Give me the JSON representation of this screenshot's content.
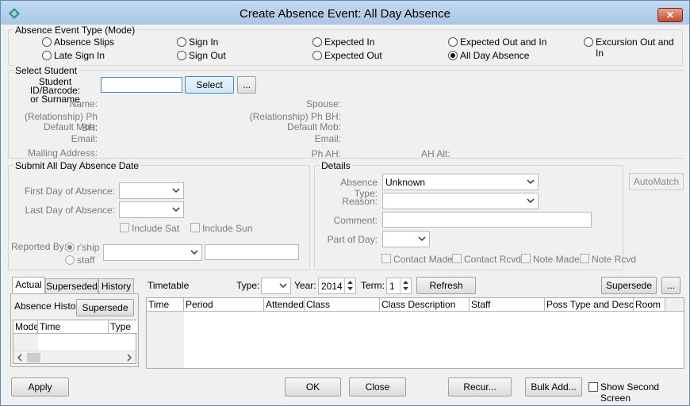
{
  "window": {
    "title": "Create Absence Event: All Day Absence",
    "close": "✕"
  },
  "mode": {
    "label": "Absence Event Type (Mode)",
    "options": [
      {
        "label": "Absence Slips",
        "checked": false
      },
      {
        "label": "Sign In",
        "checked": false
      },
      {
        "label": "Expected In",
        "checked": false
      },
      {
        "label": "Expected Out and In",
        "checked": false
      },
      {
        "label": "Excursion Out and In",
        "checked": false
      },
      {
        "label": "Late Sign In",
        "checked": false
      },
      {
        "label": "Sign Out",
        "checked": false
      },
      {
        "label": "Expected Out",
        "checked": false
      },
      {
        "label": "All Day Absence",
        "checked": true
      }
    ]
  },
  "student": {
    "label": "Select Student",
    "id_label_line1": "Student ID/Barcode:",
    "id_label_line2": "or Surname",
    "id_value": "",
    "select_button": "Select",
    "more_button": "...",
    "name_label": "Name:",
    "relationship_label": "(Relationship) Ph BH:",
    "default_mob_label": "Default Mob:",
    "email_label": "Email:",
    "mailing_label": "Mailing Address:",
    "spouse_label": "Spouse:",
    "spouse_relationship_label": "(Relationship) Ph BH:",
    "spouse_default_mob_label": "Default Mob:",
    "spouse_email_label": "Email:",
    "ph_ah_label": "Ph AH:",
    "ah_alt_label": "AH Alt:"
  },
  "submit": {
    "label": "Submit All Day Absence Date",
    "first_day_label": "First Day of Absence:",
    "last_day_label": "Last Day of Absence:",
    "include_sat": "Include Sat",
    "include_sun": "Include Sun",
    "reported_by_label": "Reported By:",
    "rship": "r'ship",
    "staff": "staff"
  },
  "details": {
    "label": "Details",
    "automatch": "AutoMatch",
    "absence_type_label": "Absence Type:",
    "absence_type_value": "Unknown",
    "reason_label": "Reason:",
    "comment_label": "Comment:",
    "part_of_day_label": "Part of Day:",
    "contact_made": "Contact Made",
    "contact_rcvd": "Contact Rcvd",
    "note_made": "Note Made",
    "note_rcvd": "Note Rcvd"
  },
  "left_tabs": {
    "tabs": [
      "Actual",
      "Superseded",
      "History"
    ],
    "absence_history_label": "Absence History",
    "supersede_button": "Supersede",
    "columns": [
      "Mode",
      "Time",
      "Type"
    ]
  },
  "timetable": {
    "label": "Timetable",
    "type_label": "Type:",
    "year_label": "Year:",
    "year_value": "2014",
    "term_label": "Term:",
    "term_value": "1",
    "refresh_button": "Refresh",
    "supersede_button": "Supersede",
    "more_button": "...",
    "columns": [
      "Time",
      "Period",
      "Attended",
      "Class",
      "Class Description",
      "Staff",
      "Poss Type and Desc",
      "Room"
    ]
  },
  "footer": {
    "apply": "Apply",
    "ok": "OK",
    "close": "Close",
    "recur": "Recur...",
    "bulk_add": "Bulk Add...",
    "show_second_screen": "Show Second Screen"
  }
}
